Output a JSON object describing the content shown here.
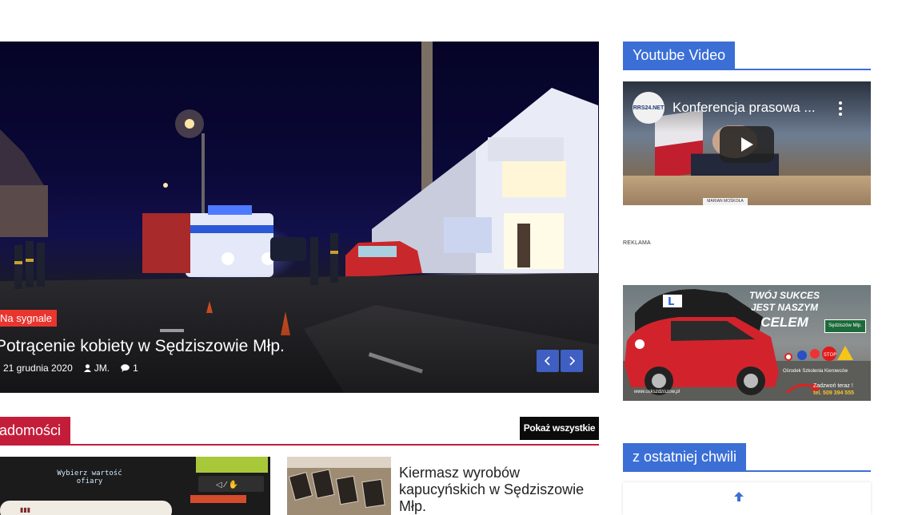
{
  "slider": {
    "category": "Na sygnale",
    "title": "Potrącenie kobiety w Sędziszowie Młp.",
    "date": "21 grudnia 2020",
    "author": "JM.",
    "comments": "1",
    "prev_icon": "chevron-left-icon",
    "next_icon": "chevron-right-icon"
  },
  "news_section": {
    "title": "Wiadomości",
    "show_all": "Pokaż wszystkie",
    "big_image_text": "Wybierz wartość ofiary",
    "small_article_title": "Kiermasz wyrobów kapucyńskich w Sędziszowie Młp."
  },
  "sidebar": {
    "youtube_heading": "Youtube Video",
    "video": {
      "channel_logo": "RRS24.NET",
      "title": "Konferencja prasowa ...",
      "nameplate": "MARIAN MOŚKOŁA"
    },
    "ad_label": "REKLAMA",
    "ad": {
      "slogan_line1": "TWÓJ SUKCES",
      "slogan_line2": "JEST NASZYM",
      "slogan_line3": "CELEM",
      "road_sign": "Sędziszów Młp.",
      "school": "Ośrodek Szkolenia Kierowców",
      "call": "Zadzwoń teraz !",
      "phone": "tel. 509 394 555",
      "website": "www.oskszdziszow.pl"
    },
    "latest_heading": "z ostatniej chwili"
  },
  "colors": {
    "category_red": "#e8352e",
    "section_red": "#c41d3a",
    "sidebar_blue": "#3b6fd6",
    "slider_button_blue": "#3f5fc3",
    "show_all_black": "#0b0b0b"
  }
}
